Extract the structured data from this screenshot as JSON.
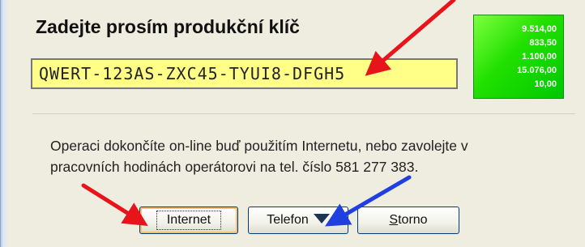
{
  "dialog": {
    "title": "Zadejte prosím produkční klíč",
    "product_key_value": "QWERT-123AS-ZXC45-TYUI8-DFGH5",
    "info_line_1": "Operaci dokončíte on-line buď použitím Internetu, nebo zavolejte v",
    "info_line_2": "pracovních hodinách operátorovi na tel. číslo 581 277 383."
  },
  "numbers_panel": {
    "values": [
      "9.514,00",
      "833,50",
      "1.100,00",
      "15.076,00",
      "10,00"
    ]
  },
  "buttons": {
    "internet_label": "Internet",
    "telefon_label": "Telefon",
    "storno_first_letter": "S",
    "storno_rest": "torno"
  },
  "colors": {
    "annotation_red": "#e8141c",
    "annotation_blue": "#1f3fe0",
    "key_field_background": "#ffff88",
    "panel_green": "#21e000"
  },
  "icons": {
    "dropdown": "triangle-down"
  }
}
